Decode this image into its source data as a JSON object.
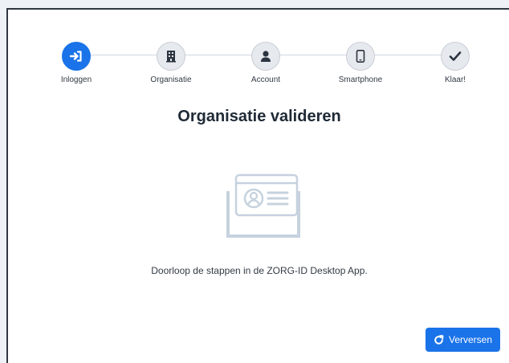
{
  "steps": [
    {
      "label": "Inloggen",
      "icon": "sign-in-icon",
      "active": true
    },
    {
      "label": "Organisatie",
      "icon": "building-icon",
      "active": false
    },
    {
      "label": "Account",
      "icon": "user-icon",
      "active": false
    },
    {
      "label": "Smartphone",
      "icon": "smartphone-icon",
      "active": false
    },
    {
      "label": "Klaar!",
      "icon": "check-icon",
      "active": false
    }
  ],
  "page": {
    "title": "Organisatie valideren",
    "instruction": "Doorloop de stappen in de ZORG-ID Desktop App."
  },
  "actions": {
    "refresh_label": "Verversen"
  },
  "colors": {
    "accent": "#1a73e8",
    "step_inactive_bg": "#e6e9ed",
    "icon_dark": "#2b3440",
    "illustration": "#c6d2de"
  }
}
